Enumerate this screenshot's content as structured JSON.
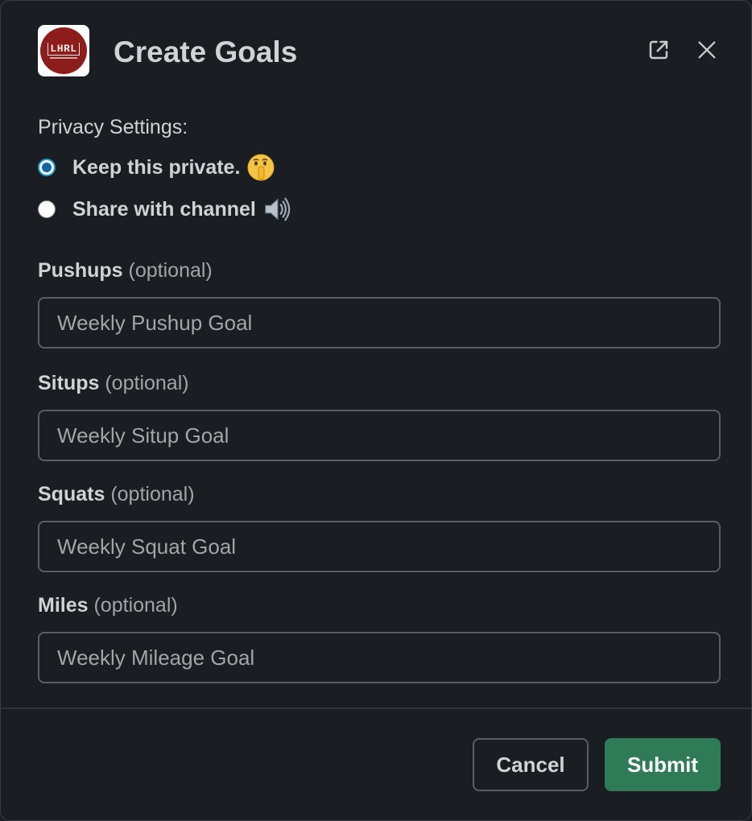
{
  "header": {
    "logo_text": "LHRL",
    "title": "Create Goals",
    "popout_icon": "external-link-icon",
    "close_icon": "close-icon"
  },
  "privacy": {
    "label": "Privacy Settings:",
    "options": [
      {
        "label": "Keep this private.",
        "emoji": "shushing-face-emoji",
        "selected": true
      },
      {
        "label": "Share with channel",
        "emoji": "loudspeaker-emoji",
        "selected": false
      }
    ]
  },
  "fields": [
    {
      "name": "Pushups",
      "optional": "(optional)",
      "placeholder": "Weekly Pushup Goal",
      "value": ""
    },
    {
      "name": "Situps",
      "optional": "(optional)",
      "placeholder": "Weekly Situp Goal",
      "value": ""
    },
    {
      "name": "Squats",
      "optional": "(optional)",
      "placeholder": "Weekly Squat Goal",
      "value": ""
    },
    {
      "name": "Miles",
      "optional": "(optional)",
      "placeholder": "Weekly Mileage Goal",
      "value": ""
    }
  ],
  "footer": {
    "cancel_label": "Cancel",
    "submit_label": "Submit"
  },
  "colors": {
    "background": "#1a1d21",
    "accent_radio": "#1264a3",
    "submit_button": "#2f7a57",
    "logo_red": "#8d1d1a"
  }
}
